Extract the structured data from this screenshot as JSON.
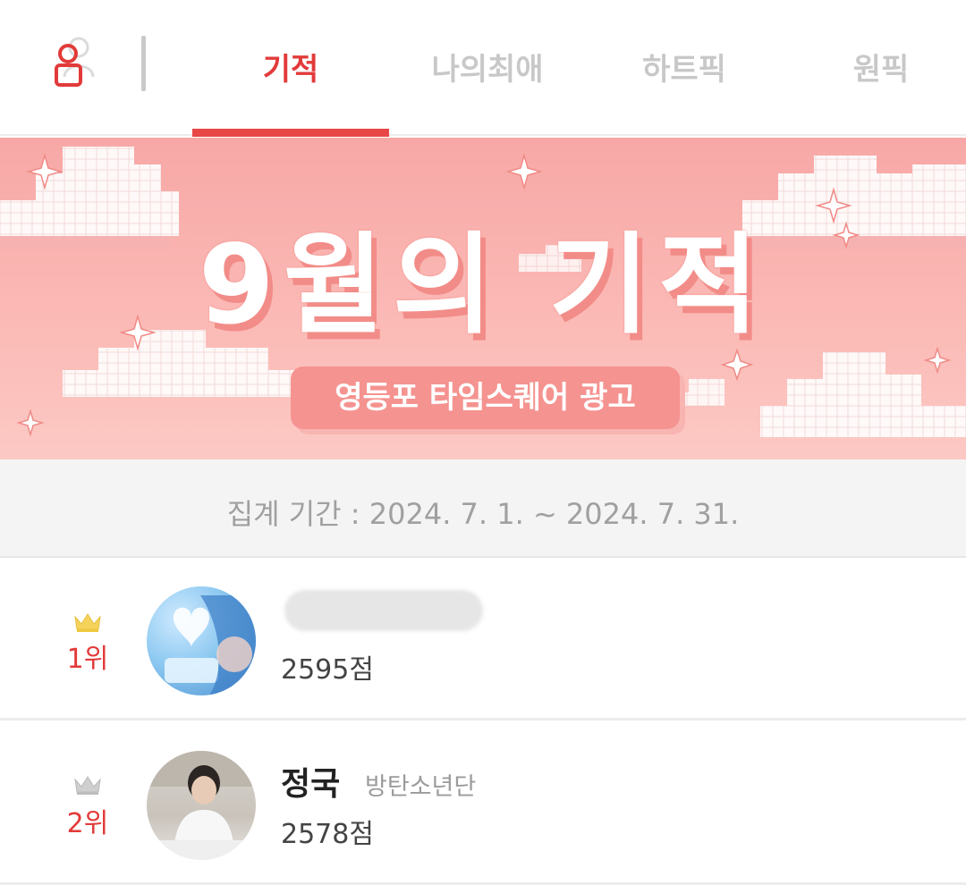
{
  "nav": {
    "tabs": [
      {
        "label": "기적",
        "active": true
      },
      {
        "label": "나의최애",
        "active": false
      },
      {
        "label": "하트픽",
        "active": false
      },
      {
        "label": "원픽",
        "active": false
      }
    ],
    "accent_color": "#e23a3a"
  },
  "banner": {
    "title": "9월의 기적",
    "subtitle": "영등포 타임스퀘어 광고"
  },
  "period": {
    "label": "집계 기간 :",
    "range": "2024. 7. 1. ~ 2024. 7. 31."
  },
  "rankings": [
    {
      "rank": "1위",
      "crown": "gold-crown-icon",
      "name": "",
      "group": "",
      "score": "2595점",
      "name_redacted": true
    },
    {
      "rank": "2위",
      "crown": "silver-crown-icon",
      "name": "정국",
      "group": "방탄소년단",
      "score": "2578점",
      "name_redacted": false
    }
  ]
}
